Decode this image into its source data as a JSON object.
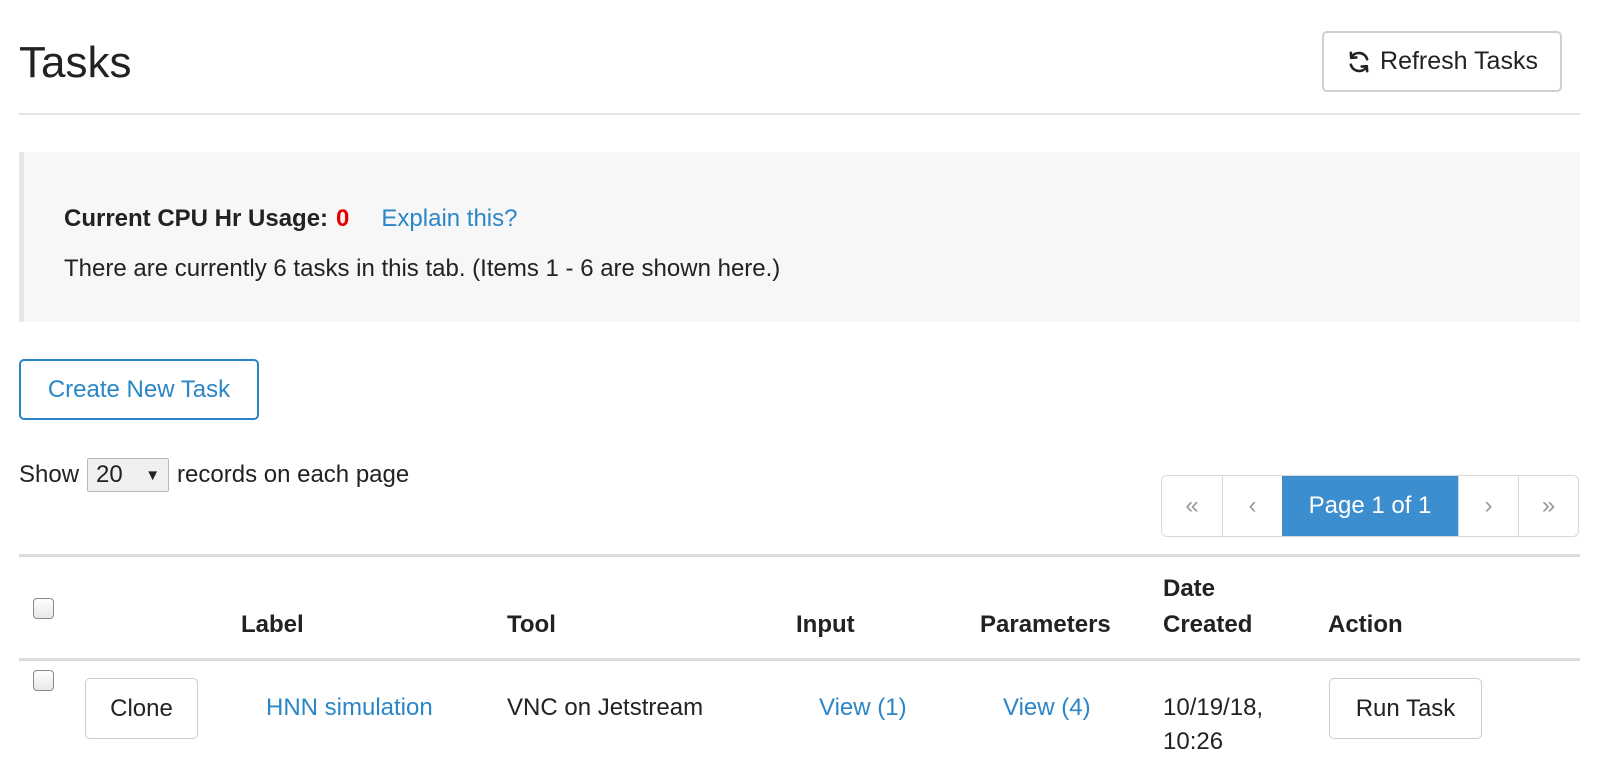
{
  "header": {
    "title": "Tasks",
    "refresh_label": "Refresh Tasks"
  },
  "usage": {
    "label": "Current CPU Hr Usage:",
    "value": "0",
    "explain_link": "Explain this?",
    "task_count_text": "There are currently 6 tasks in this tab. (Items 1 - 6 are shown here.)"
  },
  "actions": {
    "create_label": "Create New Task"
  },
  "records": {
    "show_label": "Show",
    "selected": "20",
    "suffix_label": "records on each page"
  },
  "pagination": {
    "first": "«",
    "prev": "‹",
    "current": "Page 1 of 1",
    "next": "›",
    "last": "»"
  },
  "table": {
    "columns": {
      "label": "Label",
      "tool": "Tool",
      "input": "Input",
      "parameters": "Parameters",
      "date_line1": "Date",
      "date_line2": "Created",
      "action": "Action"
    },
    "rows": [
      {
        "clone_label": "Clone",
        "label": "HNN simulation",
        "tool": "VNC on Jetstream",
        "input": "View (1)",
        "parameters": "View (4)",
        "date_line1": "10/19/18,",
        "date_line2": "10:26",
        "action_label": "Run Task"
      }
    ]
  },
  "colors": {
    "link": "#2a86c6",
    "usage_value": "#e60000",
    "pager_active": "#3d8ece"
  }
}
